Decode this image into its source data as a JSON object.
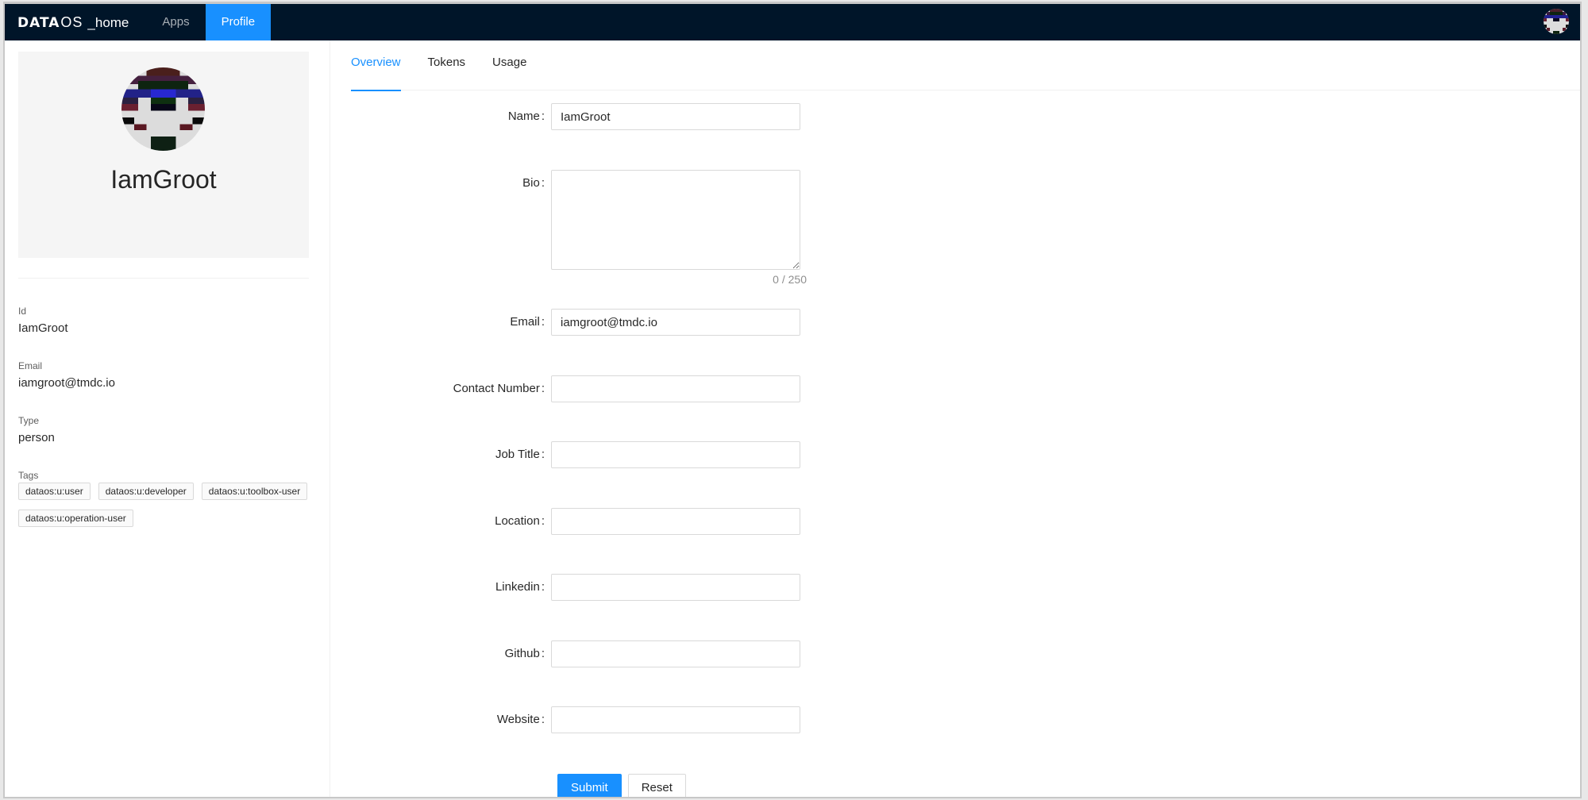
{
  "app": {
    "brand": "DATA",
    "brand_suffix": "OS",
    "workspace": "_home"
  },
  "nav": {
    "items": [
      {
        "label": "Apps",
        "active": false
      },
      {
        "label": "Profile",
        "active": true
      }
    ]
  },
  "colors": {
    "topbar": "#001529",
    "accent": "#1890ff",
    "card_bg": "#f5f5f5"
  },
  "profile_card": {
    "name": "IamGroot",
    "avatar_icon": "pixel-identicon"
  },
  "details": {
    "id_label": "Id",
    "id_value": "IamGroot",
    "email_label": "Email",
    "email_value": "iamgroot@tmdc.io",
    "type_label": "Type",
    "type_value": "person",
    "tags_label": "Tags",
    "tags": [
      "dataos:u:user",
      "dataos:u:developer",
      "dataos:u:toolbox-user",
      "dataos:u:operation-user"
    ]
  },
  "tabs": [
    {
      "label": "Overview",
      "active": true
    },
    {
      "label": "Tokens",
      "active": false
    },
    {
      "label": "Usage",
      "active": false
    }
  ],
  "form": {
    "name": {
      "label": "Name",
      "value": "IamGroot"
    },
    "bio": {
      "label": "Bio",
      "value": "",
      "counter": "0 / 250"
    },
    "email": {
      "label": "Email",
      "value": "iamgroot@tmdc.io"
    },
    "contact": {
      "label": "Contact Number",
      "value": ""
    },
    "job_title": {
      "label": "Job Title",
      "value": ""
    },
    "location": {
      "label": "Location",
      "value": ""
    },
    "linkedin": {
      "label": "Linkedin",
      "value": ""
    },
    "github": {
      "label": "Github",
      "value": ""
    },
    "website": {
      "label": "Website",
      "value": ""
    },
    "colon": ":",
    "submit_label": "Submit",
    "reset_label": "Reset"
  }
}
